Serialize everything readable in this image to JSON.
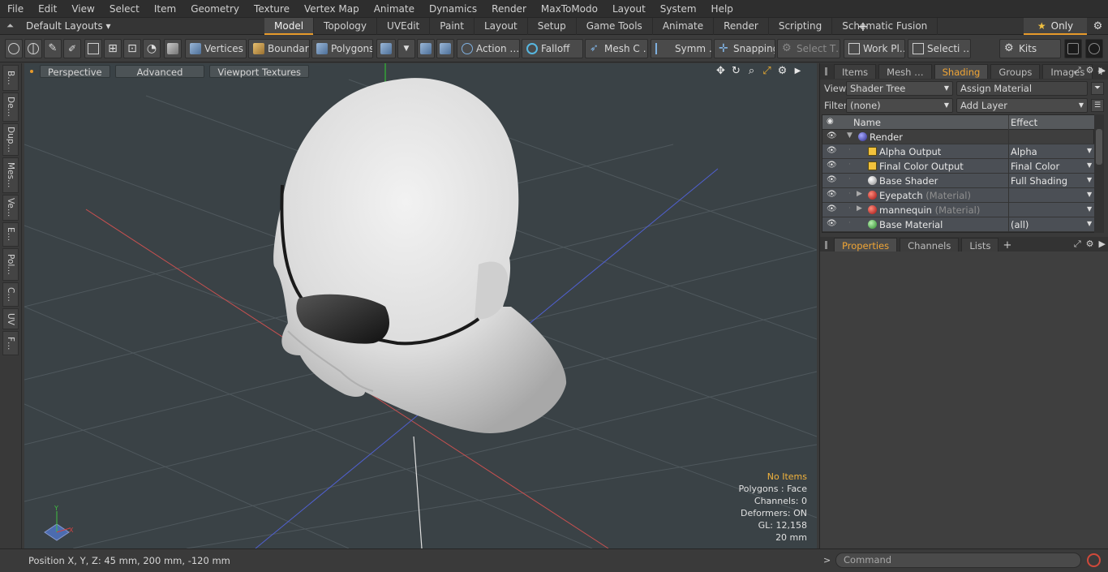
{
  "menu": [
    "File",
    "Edit",
    "View",
    "Select",
    "Item",
    "Geometry",
    "Texture",
    "Vertex Map",
    "Animate",
    "Dynamics",
    "Render",
    "MaxToModo",
    "Layout",
    "System",
    "Help"
  ],
  "layout": {
    "selector": "Default Layouts ▾",
    "tabs": [
      "Model",
      "Topology",
      "UVEdit",
      "Paint",
      "Layout",
      "Setup",
      "Game Tools",
      "Animate",
      "Render",
      "Scripting",
      "Schematic Fusion"
    ],
    "active_tab": "Model",
    "plus": "+",
    "only_label": "Only",
    "gear_icon": "⚙"
  },
  "toolbar": {
    "vertices": "Vertices",
    "boundary": "Boundary",
    "polygons": "Polygons",
    "action": "Action …",
    "falloff": "Falloff",
    "mesh": "Mesh C …",
    "symm": "Symm …",
    "snapping": "Snapping",
    "select_t": "Select T…",
    "work_pl": "Work Pl…",
    "selecti": "Selecti …",
    "kits": "Kits"
  },
  "left_tabs": [
    "B…",
    "De…",
    "Dup…",
    "Mes…",
    "Ve…",
    "E…",
    "Pol…",
    "C…",
    "UV",
    "F…"
  ],
  "viewport": {
    "buttons": [
      "Perspective",
      "Advanced",
      "Viewport Textures"
    ],
    "info": {
      "no_items": "No Items",
      "polygons": "Polygons : Face",
      "channels": "Channels: 0",
      "deformers": "Deformers: ON",
      "gl": "GL: 12,158",
      "scale": "20 mm"
    },
    "axis_y": "Y",
    "axis_x": "X"
  },
  "shading_panel": {
    "tabs": [
      "Items",
      "Mesh …",
      "Shading",
      "Groups",
      "Images"
    ],
    "active": "Shading",
    "view_label": "View",
    "view_value": "Shader Tree",
    "assign_material": "Assign Material",
    "filter_label": "Filter",
    "filter_value": "(none)",
    "add_layer": "Add Layer",
    "col_name": "Name",
    "col_effect": "Effect",
    "rows": [
      {
        "name": "Render",
        "sub": "",
        "effect": "",
        "icon": "ic-sphere-blue",
        "indent": 0,
        "expand": "▼",
        "selected": false
      },
      {
        "name": "Alpha Output",
        "sub": "",
        "effect": "Alpha",
        "icon": "ic-output",
        "indent": 1,
        "expand": "",
        "selected": true
      },
      {
        "name": "Final Color Output",
        "sub": "",
        "effect": "Final Color",
        "icon": "ic-output",
        "indent": 1,
        "expand": "",
        "selected": true
      },
      {
        "name": "Base Shader",
        "sub": "",
        "effect": "Full Shading",
        "icon": "ic-sphere-white",
        "indent": 1,
        "expand": "",
        "selected": true
      },
      {
        "name": "Eyepatch",
        "sub": "(Material)",
        "effect": "",
        "icon": "ic-sphere-red",
        "indent": 1,
        "expand": "▶",
        "selected": true
      },
      {
        "name": "mannequin",
        "sub": "(Material)",
        "effect": "",
        "icon": "ic-sphere-red",
        "indent": 1,
        "expand": "▶",
        "selected": true
      },
      {
        "name": "Base Material",
        "sub": "",
        "effect": "(all)",
        "icon": "ic-sphere-green",
        "indent": 1,
        "expand": "",
        "selected": true
      }
    ]
  },
  "properties_panel": {
    "tabs": [
      "Properties",
      "Channels",
      "Lists"
    ],
    "active": "Properties"
  },
  "status": {
    "position": "Position X, Y, Z:   45 mm, 200 mm, -120 mm",
    "command_placeholder": "Command"
  },
  "colors": {
    "accent": "#e79a2a",
    "viewport_bg": "#3a4246",
    "active_tab_text": "#f0a535",
    "info_warning": "#f2b33c"
  }
}
